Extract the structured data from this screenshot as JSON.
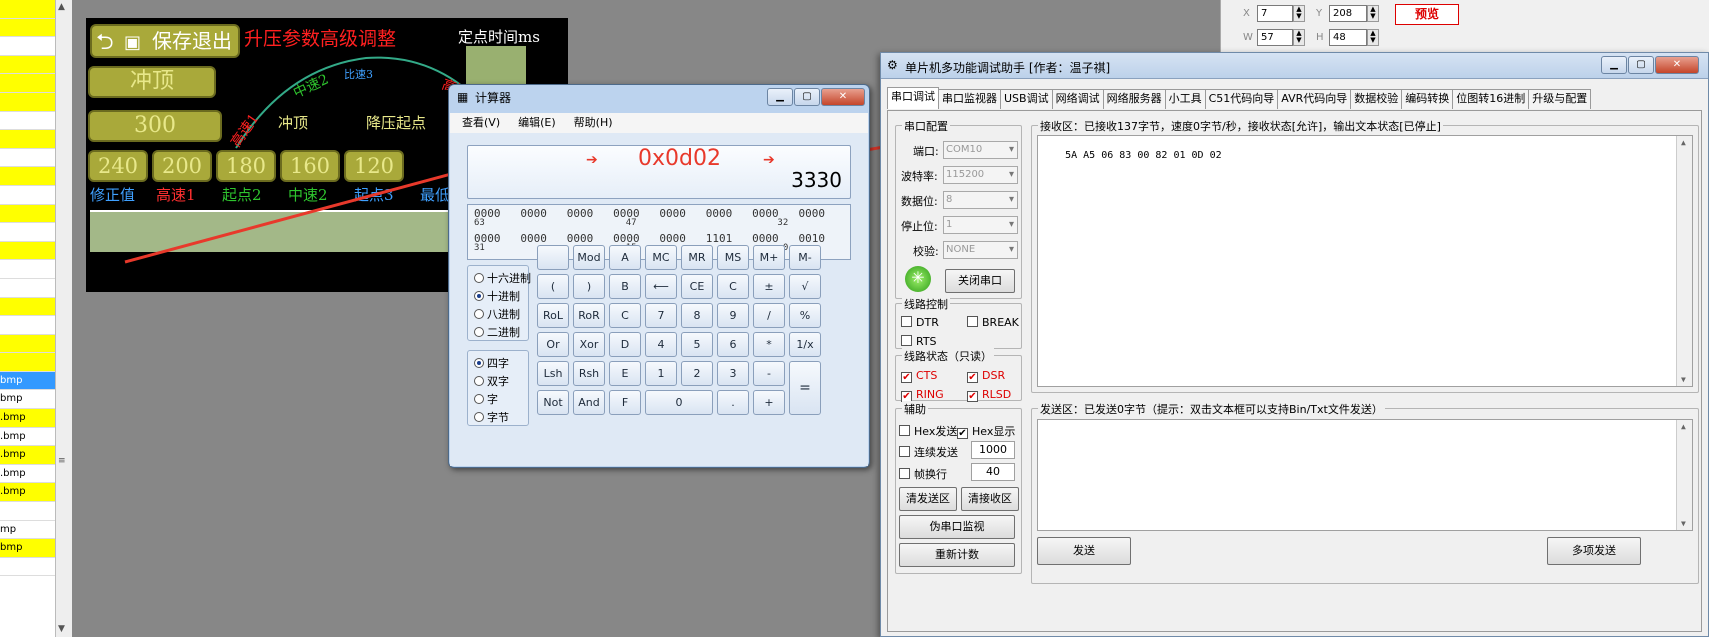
{
  "file_list": [
    {
      "label": "",
      "hl": "yellow"
    },
    {
      "label": "",
      "hl": "yellow"
    },
    {
      "label": "",
      "hl": "none"
    },
    {
      "label": "",
      "hl": "yellow"
    },
    {
      "label": "",
      "hl": "yellow"
    },
    {
      "label": "",
      "hl": "yellow"
    },
    {
      "label": "",
      "hl": "none"
    },
    {
      "label": "",
      "hl": "yellow"
    },
    {
      "label": "",
      "hl": "none"
    },
    {
      "label": "",
      "hl": "yellow"
    },
    {
      "label": "",
      "hl": "none"
    },
    {
      "label": "",
      "hl": "yellow"
    },
    {
      "label": "",
      "hl": "none"
    },
    {
      "label": "",
      "hl": "yellow"
    },
    {
      "label": "",
      "hl": "none"
    },
    {
      "label": "",
      "hl": "none"
    },
    {
      "label": "",
      "hl": "yellow"
    },
    {
      "label": "",
      "hl": "none"
    },
    {
      "label": "",
      "hl": "yellow"
    },
    {
      "label": "",
      "hl": "yellow"
    },
    {
      "label": "bmp",
      "hl": "blue"
    },
    {
      "label": "bmp",
      "hl": "none"
    },
    {
      "label": ".bmp",
      "hl": "yellow"
    },
    {
      "label": ".bmp",
      "hl": "none"
    },
    {
      "label": ".bmp",
      "hl": "yellow"
    },
    {
      "label": ".bmp",
      "hl": "none"
    },
    {
      "label": ".bmp",
      "hl": "yellow"
    },
    {
      "label": "",
      "hl": "none"
    },
    {
      "label": "mp",
      "hl": "none"
    },
    {
      "label": "bmp",
      "hl": "yellow"
    },
    {
      "label": "",
      "hl": "none"
    }
  ],
  "hmi": {
    "save_exit": "保存退出",
    "title": "升压参数高级调整",
    "fixed_time": "定点时间ms",
    "field_chongding": "冲顶",
    "val_300": "300",
    "arc_gaosu1_left": "高速1",
    "arc_zhongsu2": "中速2",
    "arc_bisu3": "比速3",
    "arc_gaosu1_right": "高速1",
    "lbl_chongding": "冲顶",
    "lbl_jiangya": "降压起点",
    "nums": [
      "240",
      "200",
      "180",
      "160",
      "120"
    ],
    "row_labels": [
      {
        "text": "修正值",
        "color": "#3fa0ff"
      },
      {
        "text": "高速1",
        "color": "#ff3030"
      },
      {
        "text": "起点2",
        "color": "#2ec42e"
      },
      {
        "text": "中速2",
        "color": "#2ec42e"
      },
      {
        "text": "起点3",
        "color": "#3fa0ff"
      },
      {
        "text": "最低",
        "color": "#3fa0ff"
      }
    ]
  },
  "props": {
    "x_label": "X",
    "x_value": "7",
    "y_label": "Y",
    "y_value": "208",
    "w_label": "W",
    "w_value": "57",
    "h_label": "H",
    "h_value": "48",
    "preview": "预览"
  },
  "calculator": {
    "title": "计算器",
    "menu": [
      "查看(V)",
      "编辑(E)",
      "帮助(H)"
    ],
    "display_value": "3330",
    "annotation": "0x0d02",
    "bits": {
      "row1": "0000   0000   0000   0000   0000   0000   0000   0000",
      "row1_marks": "63                          47                          32",
      "row2": "0000   0000   0000   0000   0000   1101   0000   0010",
      "row2_marks": "31                          15                           0"
    },
    "base_modes": [
      "十六进制",
      "十进制",
      "八进制",
      "二进制"
    ],
    "word_sizes": [
      "四字",
      "双字",
      "字",
      "字节"
    ],
    "keys": {
      "row1": [
        "",
        "Mod",
        "A",
        "MC",
        "MR",
        "MS",
        "M+",
        "M-"
      ],
      "row2": [
        "(",
        ")",
        "B",
        "⟵",
        "CE",
        "C",
        "±",
        "√"
      ],
      "row3": [
        "RoL",
        "RoR",
        "C",
        "7",
        "8",
        "9",
        "/",
        "%"
      ],
      "row4": [
        "Or",
        "Xor",
        "D",
        "4",
        "5",
        "6",
        "*",
        "1/x"
      ],
      "row5": [
        "Lsh",
        "Rsh",
        "E",
        "1",
        "2",
        "3",
        "-",
        "="
      ],
      "row6": [
        "Not",
        "And",
        "F",
        "0",
        ".",
        "+"
      ]
    }
  },
  "serial": {
    "title": "单片机多功能调试助手 [作者：温子祺]",
    "tabs": [
      "串口调试",
      "串口监视器",
      "USB调试",
      "网络调试",
      "网络服务器",
      "小工具",
      "C51代码向导",
      "AVR代码向导",
      "数据校验",
      "编码转换",
      "位图转16进制",
      "升级与配置"
    ],
    "config_title": "串口配置",
    "port_label": "端口:",
    "port_value": "COM10",
    "baud_label": "波特率:",
    "baud_value": "115200",
    "data_label": "数据位:",
    "data_value": "8",
    "stop_label": "停止位:",
    "stop_value": "1",
    "parity_label": "校验:",
    "parity_value": "NONE",
    "close_port": "关闭串口",
    "line_ctrl_title": "线路控制",
    "dtr": "DTR",
    "break": "BREAK",
    "rts": "RTS",
    "line_status_title": "线路状态（只读）",
    "cts": "CTS",
    "dsr": "DSR",
    "ring": "RING",
    "rlsd": "RLSD",
    "aux_title": "辅助",
    "hex_send": "Hex发送",
    "hex_show": "Hex显示",
    "cont_send": "连续发送",
    "cont_value": "1000",
    "frame_newline": "帧换行",
    "frame_value": "40",
    "clear_send": "清发送区",
    "clear_recv": "清接收区",
    "pseudo_monitor": "伪串口监视",
    "recount": "重新计数",
    "recv_title": "接收区：已接收137字节，速度0字节/秒，接收状态[允许]，输出文本状态[已停止]",
    "recv_content": "5A A5 06 83 00 82 01 0D 02",
    "send_title": "发送区：已发送0字节（提示：双击文本框可以支持Bin/Txt文件发送）",
    "send_btn": "发送",
    "multi_send": "多项发送"
  }
}
